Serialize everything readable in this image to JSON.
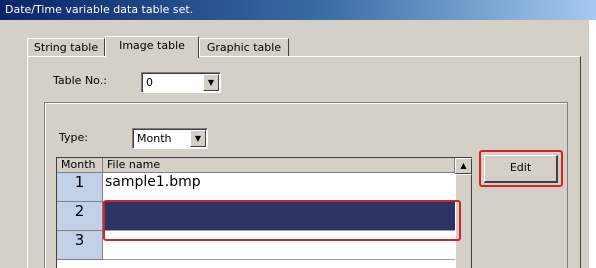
{
  "window": {
    "title": "Date/Time variable data table set."
  },
  "tabs": [
    {
      "label": "String table",
      "active": false
    },
    {
      "label": "Image table",
      "active": true
    },
    {
      "label": "Graphic table",
      "active": false
    }
  ],
  "table_no": {
    "label": "Table No.:",
    "value": "0"
  },
  "type": {
    "label": "Type:",
    "value": "Month"
  },
  "grid": {
    "columns": [
      "Month",
      "File name"
    ],
    "rows": [
      {
        "month": "1",
        "file": "sample1.bmp"
      },
      {
        "month": "2",
        "file": "",
        "selected": true
      },
      {
        "month": "3",
        "file": ""
      }
    ]
  },
  "edit_button": {
    "label": "Edit"
  },
  "icons": {
    "dropdown": "chevron-down-icon",
    "scroll_up": "arrow-up-icon"
  },
  "colors": {
    "highlight": "#d1232a",
    "selection": "#2e3366",
    "row_header": "#c3d1e8"
  }
}
